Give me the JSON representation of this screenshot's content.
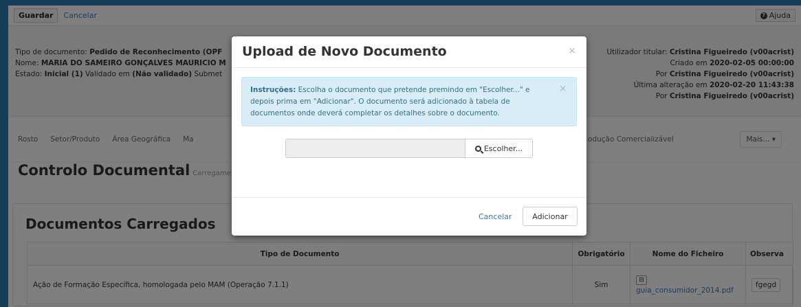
{
  "toolbar": {
    "save_label": "Guardar",
    "cancel_label": "Cancelar",
    "help_label": "Ajuda"
  },
  "info": {
    "doc_type_label": "Tipo de documento:",
    "doc_type_value": "Pedido de Reconhecimento (OPF",
    "name_label": "Nome:",
    "name_value": "MARIA DO SAMEIRO GONÇALVES MAURICIO M",
    "state_label": "Estado:",
    "state_value": "Inicial (1)",
    "validated_label": "Validado em",
    "validated_value": "(Não validado)",
    "submitted_label": "Submet",
    "owner_label": "Utilizador titular:",
    "owner_value": "Cristina Figueiredo (v00acrist)",
    "created_label": "Criado em",
    "created_value": "2020-02-05 00:00:00",
    "created_by_label": "Por",
    "created_by_value": "Cristina Figueiredo (v00acrist)",
    "modified_label": "Última alteração em",
    "modified_value": "2020-02-20 11:43:38",
    "modified_by_label": "Por",
    "modified_by_value": "Cristina Figueiredo (v00acrist)"
  },
  "tabs": {
    "items": [
      "Rosto",
      "Setor/Produto",
      "Área Geográfica",
      "Ma"
    ],
    "right_item": "odução Comercializável",
    "more_label": "Mais... ▾"
  },
  "control": {
    "title": "Controlo Documental",
    "subtitle": "Carregamento"
  },
  "docs": {
    "title": "Documentos Carregados",
    "headers": [
      "Tipo de Documento",
      "Obrigatório",
      "Nome do Ficheiro",
      "Observa"
    ],
    "rows": [
      {
        "type": "Ação de Formação Específica, homologada pelo MAM (Operação 7.1.1)",
        "required": "Sim",
        "file": "guia_consumidor_2014.pdf",
        "obs": "fgegd"
      }
    ]
  },
  "modal": {
    "title": "Upload de Novo Documento",
    "close": "×",
    "alert_label": "Instruções:",
    "alert_text": "Escolha o documento que pretende premindo em \"Escolher...\" e depois prima em \"Adicionar\". O documento será adicionado à tabela de documentos onde deverá completar os detalhes sobre o documento.",
    "alert_close": "×",
    "choose_label": "Escolher...",
    "cancel_label": "Cancelar",
    "add_label": "Adicionar"
  }
}
